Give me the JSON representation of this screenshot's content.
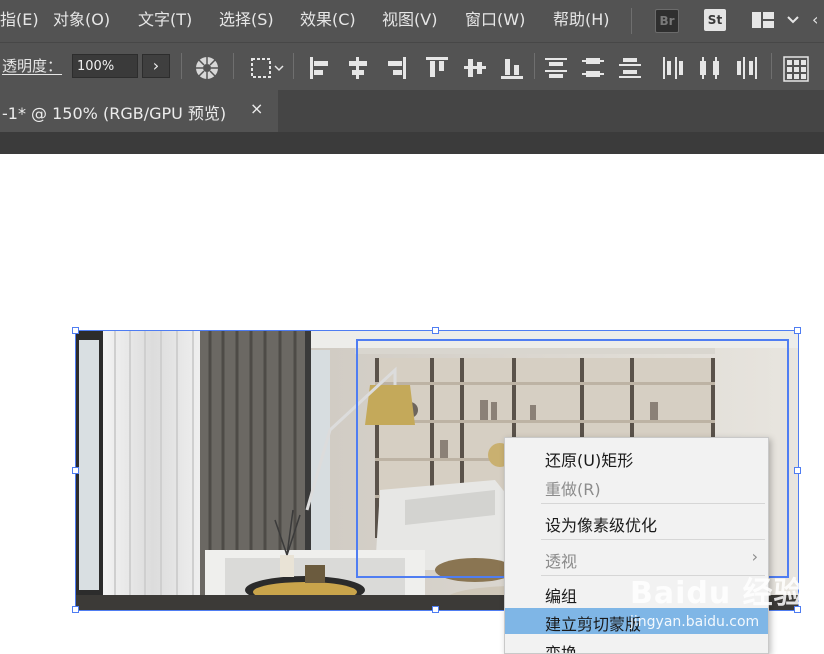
{
  "menubar": {
    "items": [
      "指(E)",
      "对象(O)",
      "文字(T)",
      "选择(S)",
      "效果(C)",
      "视图(V)",
      "窗口(W)",
      "帮助(H)"
    ],
    "bridge_badge": "Br",
    "stock_badge": "St",
    "icons": [
      "workspace-layout-icon",
      "chevron-down-icon"
    ]
  },
  "control": {
    "opacity_label": "透明度：",
    "opacity_value": "100%",
    "opacity_arrow": "›",
    "icons": [
      "recolor-artwork-icon",
      "select-similar-icon",
      "align-left-icon",
      "align-center-horizontal-icon",
      "align-right-icon",
      "align-top-icon",
      "align-center-vertical-icon",
      "align-bottom-icon",
      "distribute-top-icon",
      "distribute-center-vertical-icon",
      "distribute-bottom-icon",
      "distribute-left-icon",
      "distribute-center-horizontal-icon",
      "distribute-right-icon",
      "transform-grid-icon"
    ]
  },
  "tab": {
    "title": "-1* @ 150% (RGB/GPU 预览)",
    "close": "×"
  },
  "context_menu": {
    "items": [
      {
        "label": "还原(U)矩形",
        "enabled": true
      },
      {
        "label": "重做(R)",
        "enabled": false
      },
      {
        "label": "设为像素级优化",
        "enabled": true
      },
      {
        "label": "透视",
        "enabled": false,
        "submenu": true
      },
      {
        "label": "编组",
        "enabled": true
      },
      {
        "label": "建立剪切蒙版",
        "enabled": true,
        "highlighted": true
      },
      {
        "label": "变换",
        "enabled": true
      }
    ],
    "submenu_arrow": "›"
  },
  "watermark": {
    "text": "Baidu 经验",
    "url": "jingyan.baidu.com"
  },
  "colors": {
    "ui_dark": "#535353",
    "selection_blue": "#4f7df2",
    "menu_highlight": "#7fb6e6"
  }
}
